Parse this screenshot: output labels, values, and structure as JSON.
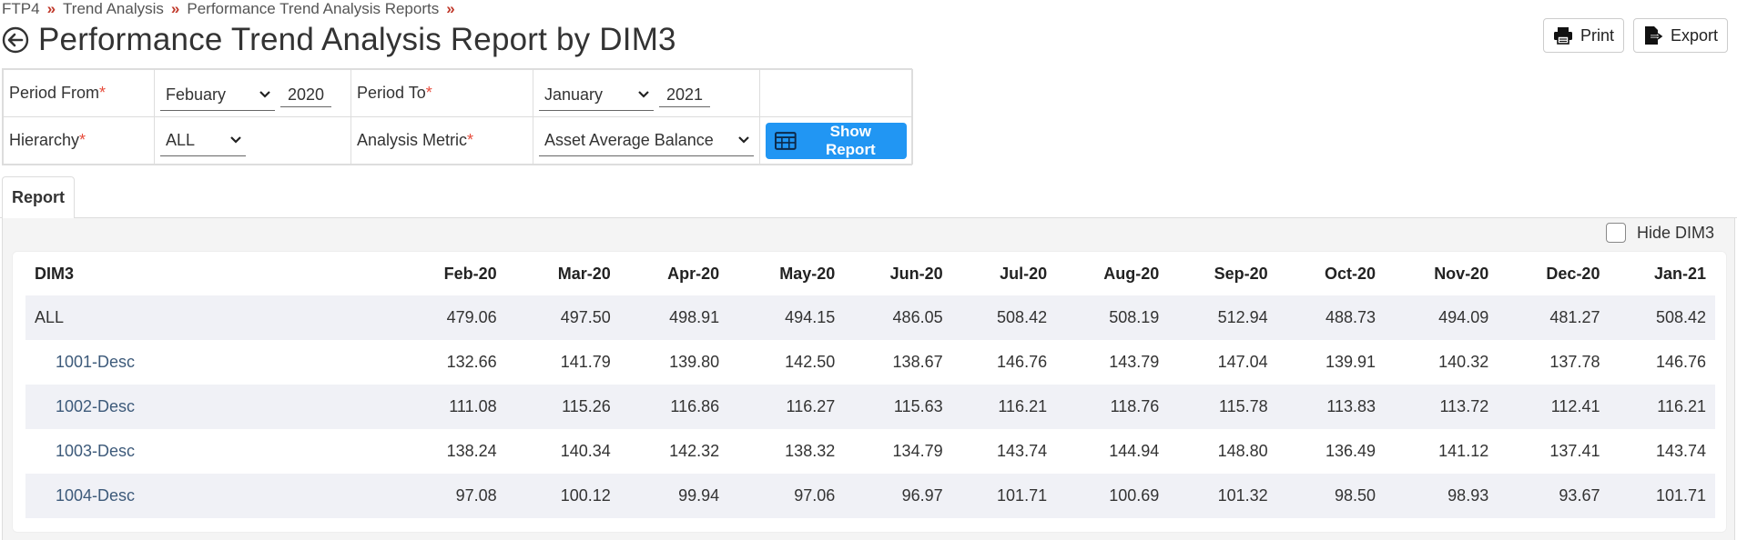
{
  "breadcrumb": [
    "FTP4",
    "Trend Analysis",
    "Performance Trend Analysis Reports"
  ],
  "breadcrumb_sep": "»",
  "page_title": "Performance Trend Analysis Report by DIM3",
  "toolbar": {
    "print_label": "Print",
    "export_label": "Export"
  },
  "filters": {
    "period_from_label": "Period From",
    "period_from_month": "Febuary",
    "period_from_year": "2020",
    "period_to_label": "Period To",
    "period_to_month": "January",
    "period_to_year": "2021",
    "hierarchy_label": "Hierarchy",
    "hierarchy_value": "ALL",
    "metric_label": "Analysis Metric",
    "metric_value": "Asset Average Balance",
    "required_mark": "*",
    "show_report_label": "Show Report"
  },
  "tabs": [
    {
      "label": "Report",
      "active": true
    }
  ],
  "hide_dim3_label": "Hide DIM3",
  "hide_dim3_checked": false,
  "report": {
    "columns": [
      "DIM3",
      "Feb-20",
      "Mar-20",
      "Apr-20",
      "May-20",
      "Jun-20",
      "Jul-20",
      "Aug-20",
      "Sep-20",
      "Oct-20",
      "Nov-20",
      "Dec-20",
      "Jan-21"
    ],
    "rows": [
      {
        "name": "ALL",
        "values": [
          "479.06",
          "497.50",
          "498.91",
          "494.15",
          "486.05",
          "508.42",
          "508.19",
          "512.94",
          "488.73",
          "494.09",
          "481.27",
          "508.42"
        ]
      },
      {
        "name": "1001-Desc",
        "values": [
          "132.66",
          "141.79",
          "139.80",
          "142.50",
          "138.67",
          "146.76",
          "143.79",
          "147.04",
          "139.91",
          "140.32",
          "137.78",
          "146.76"
        ]
      },
      {
        "name": "1002-Desc",
        "values": [
          "111.08",
          "115.26",
          "116.86",
          "116.27",
          "115.63",
          "116.21",
          "118.76",
          "115.78",
          "113.83",
          "113.72",
          "112.41",
          "116.21"
        ]
      },
      {
        "name": "1003-Desc",
        "values": [
          "138.24",
          "140.34",
          "142.32",
          "138.32",
          "134.79",
          "143.74",
          "144.94",
          "148.80",
          "136.49",
          "141.12",
          "137.41",
          "143.74"
        ]
      },
      {
        "name": "1004-Desc",
        "values": [
          "97.08",
          "100.12",
          "99.94",
          "97.06",
          "96.97",
          "101.71",
          "100.69",
          "101.32",
          "98.50",
          "98.93",
          "93.67",
          "101.71"
        ]
      }
    ]
  },
  "colors": {
    "accent": "#2196f3",
    "required": "#e74c3c",
    "breadcrumb_sep": "#c0392b",
    "row_shade": "#f0f1f6"
  },
  "icons": {
    "back": "arrow-left-circle-icon",
    "print": "printer-icon",
    "export": "export-icon",
    "table": "table-icon"
  }
}
